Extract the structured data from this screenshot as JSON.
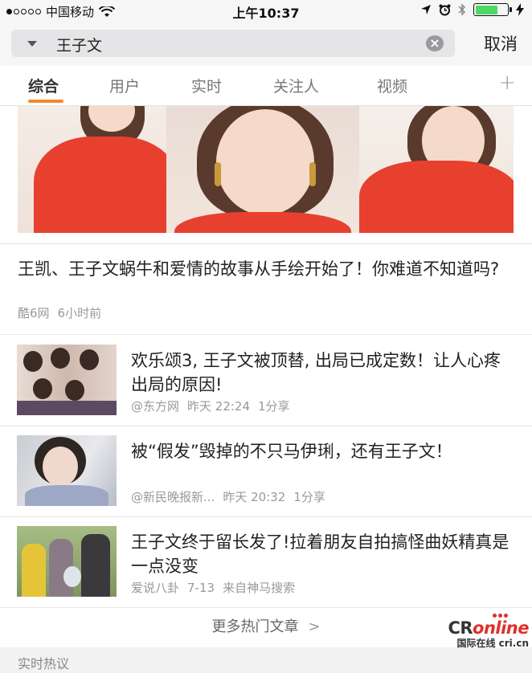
{
  "status_bar": {
    "carrier": "中国移动",
    "time": "上午10:37",
    "battery_color": "#4cd964"
  },
  "search": {
    "query": "王子文",
    "cancel_label": "取消",
    "clear_icon": "clear-icon"
  },
  "tabs": [
    {
      "label": "综合",
      "active": true
    },
    {
      "label": "用户"
    },
    {
      "label": "实时"
    },
    {
      "label": "关注人"
    },
    {
      "label": "视频"
    }
  ],
  "tab_accent": "#f28a2a",
  "feature_article": {
    "title": "王凯、王子文蜗牛和爱情的故事从手绘开始了！你难道不知道吗?",
    "source": "酷6网",
    "time": "6小时前"
  },
  "articles": [
    {
      "title": "欢乐颂3, 王子文被顶替, 出局已成定数！让人心疼出局的原因!",
      "source": "@东方网",
      "time": "昨天 22:24",
      "shares": "1分享"
    },
    {
      "title": "被“假发”毁掉的不只马伊琍，还有王子文！",
      "source": "@新民晚报新...",
      "time": "昨天 20:32",
      "shares": "1分享"
    },
    {
      "title": "王子文终于留长发了!拉着朋友自拍搞怪曲妖精真是一点没变",
      "source": "爱说八卦",
      "time": "7-13",
      "shares": "来自神马搜索"
    }
  ],
  "more_label": "更多热门文章",
  "section_title": "实时热议",
  "watermark": {
    "logo_cr": "CR",
    "logo_online": "online",
    "sub": "国际在线 cri.cn"
  }
}
